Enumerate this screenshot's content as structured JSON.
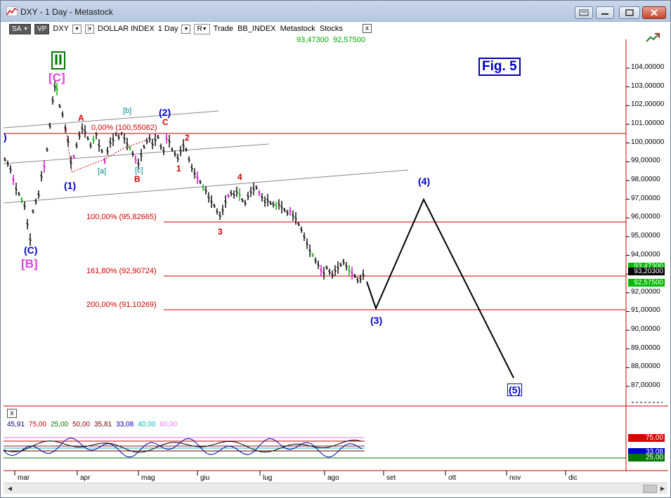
{
  "window": {
    "title": "DXY - 1 Day - Metastock",
    "buttons": {
      "restore_icon": "restore-icon",
      "minimize": "minimize-icon",
      "maximize": "maximize-icon",
      "close": "close-icon"
    }
  },
  "toolbar": {
    "mode": "SA",
    "vp": "VP",
    "symbol": "DXY",
    "instrument_name": "DOLLAR INDEX",
    "period": "1 Day",
    "indicator_toggle": "R",
    "source_text": "Trade  BB_INDEX  Metastock  Stocks",
    "close_label": "x"
  },
  "last_prices": {
    "high": "93,47300",
    "low": "92,57500"
  },
  "figure_label": "Fig. 5",
  "price_axis": {
    "labels": [
      "104,00000",
      "103,00000",
      "102,00000",
      "101,00000",
      "100,00000",
      "99,00000",
      "98,00000",
      "97,00000",
      "96,00000",
      "95,00000",
      "94,00000",
      "93,00000",
      "92,00000",
      "91,00000",
      "90,00000",
      "89,00000",
      "88,00000",
      "87,00000"
    ],
    "tags": [
      {
        "text": "93,47300",
        "color": "#00bb00"
      },
      {
        "text": "93,20300",
        "color": "#000000"
      },
      {
        "text": "92,57500",
        "color": "#00bb00"
      }
    ]
  },
  "date_axis": [
    "mar",
    "apr",
    "mag",
    "giu",
    "lug",
    "ago",
    "set",
    "ott",
    "nov",
    "dic"
  ],
  "fibonacci": [
    {
      "label": "0,00% (100,55062)",
      "price": 100.55
    },
    {
      "label": "100,00% (95,82665)",
      "price": 95.83
    },
    {
      "label": "161,80% (92,90724)",
      "price": 92.91
    },
    {
      "label": "200,00% (91,10269)",
      "price": 91.1
    }
  ],
  "wave_labels": {
    "major": "II",
    "bracket_c": "[C]",
    "bracket_b": "[B]",
    "paren_c": "(C)",
    "w1": "(1)",
    "w2": "(2)",
    "w3": "(3)",
    "w4": "(4)",
    "w5": "(5)",
    "sub_a": "A",
    "sub_b": "B",
    "sub_c": "C",
    "minor_a": "[a]",
    "minor_b": "[b]",
    "minor_c": "[c]",
    "i1": "1",
    "i2": "2",
    "i3": "3",
    "i4": "4",
    "edge_paren": ")"
  },
  "indicator": {
    "values": [
      {
        "text": "45,91",
        "color": "#000080"
      },
      {
        "text": "75,00",
        "color": "#cc0000"
      },
      {
        "text": "25,00",
        "color": "#007700"
      },
      {
        "text": "50,00",
        "color": "#880000"
      },
      {
        "text": "35,81",
        "color": "#660000"
      },
      {
        "text": "33,08",
        "color": "#0000aa"
      },
      {
        "text": "40,00",
        "color": "#00bbbb"
      },
      {
        "text": "60,00",
        "color": "#ee77ee"
      }
    ],
    "tags": [
      {
        "text": "75,00",
        "color": "#dd0000"
      },
      {
        "text": "33,08",
        "color": "#0000cc"
      },
      {
        "text": "25,00",
        "color": "#007700"
      }
    ],
    "close_label": "x"
  },
  "chart_data": {
    "type": "line",
    "series": [
      {
        "name": "",
        "x": [
          "mar",
          "apr",
          "mag",
          "giu",
          "lug",
          "ago"
        ],
        "values": [
          96.0,
          100.0,
          100.5,
          97.0,
          97.5,
          93.2
        ]
      }
    ],
    "projection": [
      {
        "label": "(3)",
        "price": 91.1
      },
      {
        "label": "(4)",
        "price": 97.0
      },
      {
        "label": "(5)",
        "price": 87.6
      }
    ],
    "ylim": [
      86.5,
      105.0
    ]
  }
}
